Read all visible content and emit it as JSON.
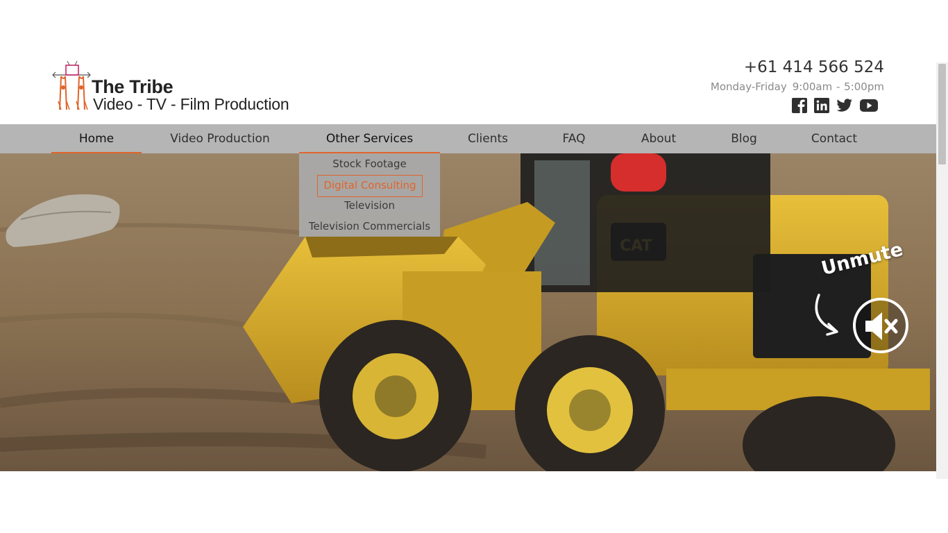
{
  "brand": {
    "title": "The Tribe",
    "subtitle": "Video - TV - Film Production"
  },
  "contact": {
    "phone": "+61 414 566 524",
    "days": "Monday-Friday",
    "hours": "9:00am - 5:00pm"
  },
  "socials": [
    {
      "name": "facebook",
      "icon": "facebook-icon"
    },
    {
      "name": "linkedin",
      "icon": "linkedin-icon"
    },
    {
      "name": "twitter",
      "icon": "twitter-icon"
    },
    {
      "name": "youtube",
      "icon": "youtube-icon"
    }
  ],
  "nav": {
    "items": [
      {
        "label": "Home"
      },
      {
        "label": "Video Production"
      },
      {
        "label": "Other Services"
      },
      {
        "label": "Clients"
      },
      {
        "label": "FAQ"
      },
      {
        "label": "About"
      },
      {
        "label": "Blog"
      },
      {
        "label": "Contact"
      }
    ],
    "active": "Home"
  },
  "dropdown": {
    "items": [
      {
        "label": "Stock Footage"
      },
      {
        "label": "Digital Consulting"
      },
      {
        "label": "Television"
      },
      {
        "label": "Television Commercials"
      }
    ],
    "highlighted": "Digital Consulting"
  },
  "hero": {
    "unmute_label": "Unmute"
  },
  "colors": {
    "accent": "#e0642b",
    "nav_bg": "#b5b5b5",
    "dropdown_bg": "#aaaaaa",
    "text_dark": "#333333",
    "text_muted": "#8a8a8a"
  }
}
